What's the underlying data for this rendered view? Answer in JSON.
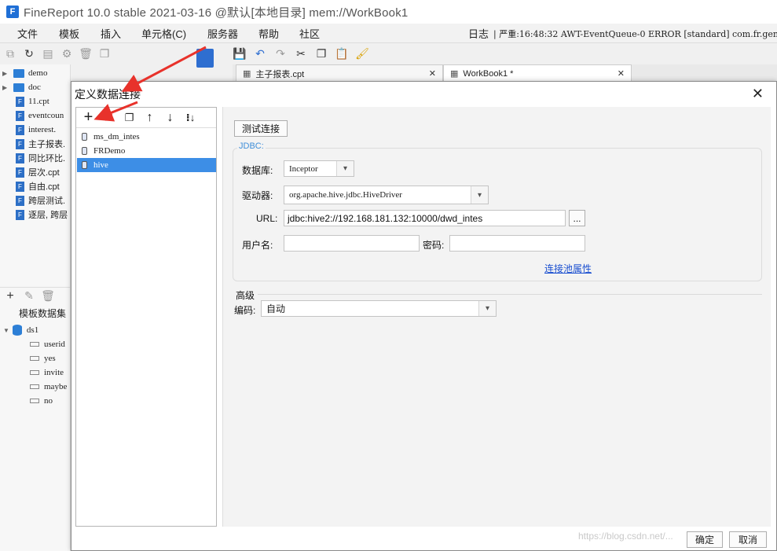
{
  "app": {
    "title": "FineReport 10.0 stable 2021-03-16 @默认[本地目录]    mem://WorkBook1",
    "logo": "F"
  },
  "menu": {
    "items": [
      "文件",
      "模板",
      "插入",
      "单元格(C)",
      "服务器",
      "帮助",
      "社区"
    ],
    "log_label": "日志",
    "status_text": "| 严重:16:48:32 AWT-EventQueue-0 ERROR [standard] com.fr.gene"
  },
  "file_tree": {
    "folders": [
      "demo",
      "doc"
    ],
    "files": [
      "11.cpt",
      "eventcoun",
      "interest.",
      "主子报表.",
      "同比环比.",
      "层次.cpt",
      "自由.cpt",
      "跨层测试.",
      "逐层, 跨层"
    ]
  },
  "dataset_panel": {
    "title": "模板数据集",
    "dataset": "ds1",
    "columns": [
      "userid",
      "yes",
      "invite",
      "maybe",
      "no"
    ]
  },
  "tabs": [
    {
      "label": "主子报表.cpt"
    },
    {
      "label": "WorkBook1 *"
    }
  ],
  "dialog": {
    "title": "定义数据连接",
    "connections": [
      "ms_dm_intes",
      "FRDemo",
      "hive"
    ],
    "selected_connection": "hive",
    "test_button": "测试连接",
    "group_label": "JDBC:",
    "database_label": "数据库:",
    "database_value": "Inceptor",
    "driver_label": "驱动器:",
    "driver_value": "org.apache.hive.jdbc.HiveDriver",
    "url_label": "URL:",
    "url_value": "jdbc:hive2://192.168.181.132:10000/dwd_intes",
    "url_browse": "...",
    "username_label": "用户名:",
    "username_value": "",
    "password_label": "密码:",
    "password_value": "",
    "pool_link": "连接池属性",
    "advanced_label": "高级",
    "encoding_label": "编码:",
    "encoding_value": "自动",
    "ok_button": "确定",
    "cancel_button": "取消"
  },
  "watermark": "https://blog.csdn.net/...",
  "colors": {
    "selection": "#3d8ee6",
    "accent_blue": "#3f8ed8",
    "link": "#1a4fd0",
    "delete_red": "#e02020",
    "arrow_red": "#e8322b"
  },
  "icons": {
    "add": "+",
    "delete": "✕",
    "copy": "copy-icon",
    "move_up": "↑",
    "move_down": "↓",
    "sort": "sort-icon"
  }
}
